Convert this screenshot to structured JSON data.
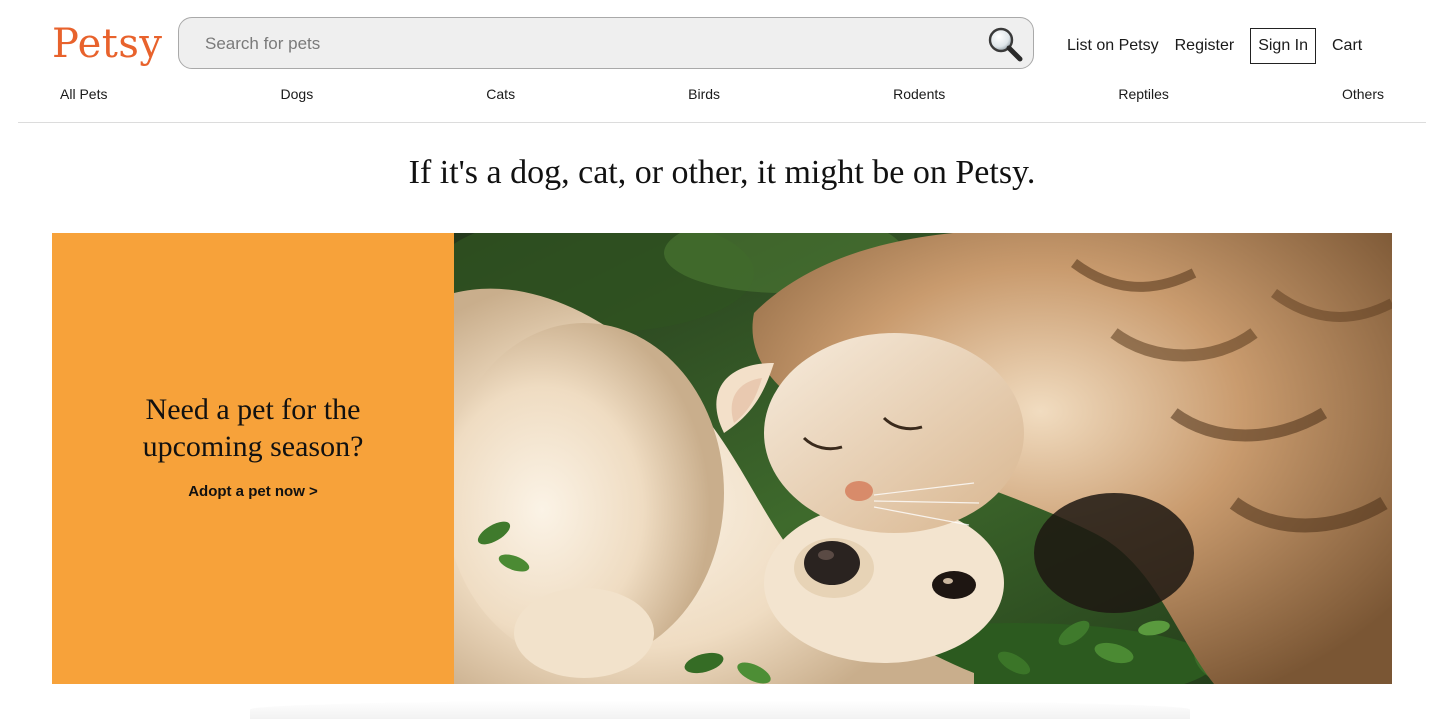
{
  "brand": {
    "logo_text": "Petsy",
    "accent_color": "#e8622c"
  },
  "search": {
    "placeholder": "Search for pets",
    "value": "",
    "icon": "search-icon"
  },
  "top_links": {
    "list": "List on Petsy",
    "register": "Register",
    "sign_in": "Sign In",
    "cart": "Cart"
  },
  "categories": [
    "All Pets",
    "Dogs",
    "Cats",
    "Birds",
    "Rodents",
    "Reptiles",
    "Others"
  ],
  "tagline": "If it's a dog, cat, or other, it might be on Petsy.",
  "hero": {
    "heading_line1": "Need a pet for the",
    "heading_line2": "upcoming season?",
    "cta": "Adopt a pet now >",
    "panel_color": "#f7a23a"
  }
}
